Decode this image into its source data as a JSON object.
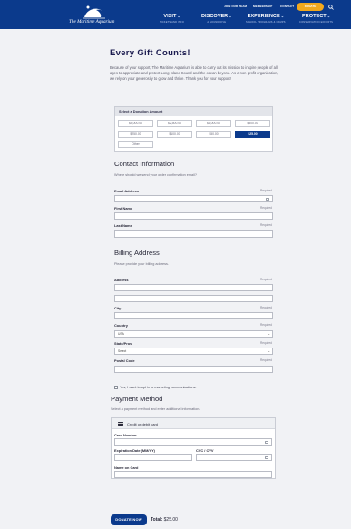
{
  "header": {
    "logo_text": "The Maritime Aquarium",
    "utility_links": [
      "JOIN OUR TEAM",
      "MEMBERSHIP",
      "CONTACT"
    ],
    "donate_label": "DONATE",
    "nav": [
      {
        "label": "VISIT",
        "sub": "TICKETS AND INFO"
      },
      {
        "label": "DISCOVER",
        "sub": "A SOUND DIVE"
      },
      {
        "label": "EXPERIENCE",
        "sub": "SCHOOL PROGRAMS & CAMPS"
      },
      {
        "label": "PROTECT",
        "sub": "CONSERVATION EFFORTS"
      }
    ]
  },
  "page": {
    "title": "Every Gift Counts!",
    "intro": "Because of your support, The Maritime Aquarium is able to carry out its mission to inspire people of all ages to appreciate and protect Long Island Sound and the ocean beyond. As a non-profit organization, we rely on your generosity to grow and thrive. Thank you for your support!"
  },
  "amounts": {
    "heading": "Select a Donation Amount",
    "options": [
      "$5,000.00",
      "$2,500.00",
      "$1,000.00",
      "$500.00",
      "$250.00",
      "$100.00",
      "$50.00",
      "$25.00",
      "Other"
    ],
    "selected": "$25.00"
  },
  "contact": {
    "heading": "Contact Information",
    "subheading": "Where should we send your order confirmation email?",
    "required_label": "Required",
    "fields": {
      "email": "Email Address",
      "first": "First Name",
      "last": "Last Name"
    }
  },
  "billing": {
    "heading": "Billing Address",
    "subheading": "Please provide your billing address.",
    "fields": {
      "address": "Address",
      "city": "City",
      "country": "Country",
      "country_value": "USA",
      "state": "State/Prov",
      "state_value": "Select",
      "postal": "Postal Code"
    }
  },
  "optin": "Yes, I want to opt in to marketing communications.",
  "payment": {
    "heading": "Payment Method",
    "subheading": "Select a payment method and enter additional information.",
    "method": "Credit or debit card",
    "fields": {
      "card": "Card Number",
      "exp": "Expiration Date (MM/YY)",
      "cvc": "CVC / CVV",
      "name": "Name on Card"
    }
  },
  "footer": {
    "donate_button": "DONATE NOW",
    "total_label": "Total:",
    "total_value": "$25.00"
  }
}
